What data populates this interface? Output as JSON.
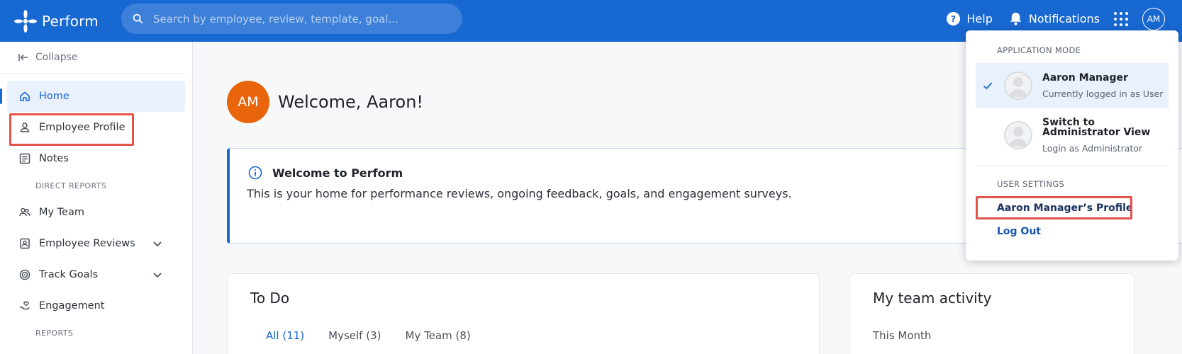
{
  "colors": {
    "primary": "#1868d2",
    "avatar": "#e8650b",
    "highlight": "#e3534a"
  },
  "header": {
    "app_name": "Perform",
    "search_placeholder": "Search by employee, review, template, goal...",
    "help": "Help",
    "notifications": "Notifications",
    "avatar_initials": "AM"
  },
  "sidebar": {
    "collapse": "Collapse",
    "items": [
      {
        "label": "Home",
        "icon": "home-icon"
      },
      {
        "label": "Employee Profile",
        "icon": "person-icon"
      },
      {
        "label": "Notes",
        "icon": "notes-icon"
      }
    ],
    "direct_reports_label": "DIRECT REPORTS",
    "report_items": [
      {
        "label": "My Team",
        "icon": "team-icon"
      },
      {
        "label": "Employee Reviews",
        "icon": "review-icon"
      },
      {
        "label": "Track Goals",
        "icon": "target-icon"
      },
      {
        "label": "Engagement",
        "icon": "engagement-icon"
      }
    ],
    "reports_label": "REPORTS"
  },
  "main": {
    "avatar_initials": "AM",
    "welcome": "Welcome, Aaron!",
    "info_title": "Welcome to Perform",
    "info_text": "This is your home for performance reviews, ongoing feedback, goals, and engagement surveys.",
    "todo": {
      "title": "To Do",
      "tabs": [
        "All (11)",
        "Myself (3)",
        "My Team (8)"
      ]
    },
    "team_activity": {
      "title": "My team activity",
      "period": "This Month"
    }
  },
  "menu": {
    "application_mode_label": "APPLICATION MODE",
    "options": [
      {
        "title": "Aaron Manager",
        "subtitle": "Currently logged in as User"
      },
      {
        "title": "Switch to Administrator View",
        "subtitle": "Login as Administrator"
      }
    ],
    "user_settings_label": "USER SETTINGS",
    "profile_link": "Aaron Manager’s Profile",
    "logout": "Log Out"
  }
}
